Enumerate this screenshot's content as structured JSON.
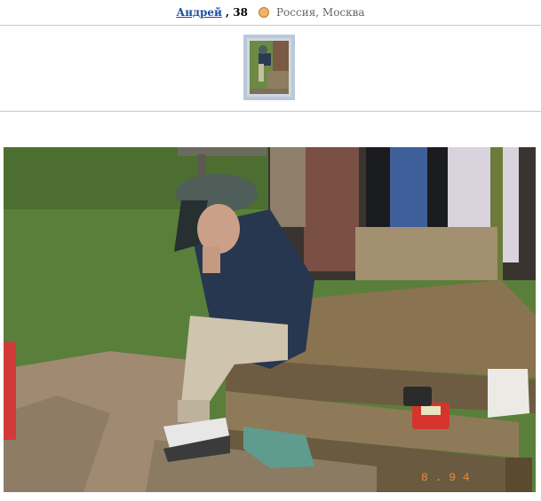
{
  "profile": {
    "name": "Андрей",
    "age": ", 38",
    "zodiac_icon": "zodiac-icon",
    "location": "Россия, Москва"
  },
  "photo": {
    "stamp": "8 . 9 4",
    "colors": {
      "grass": "#5a7f3a",
      "wood": "#8a7350",
      "jacket": "#26374f",
      "hat": "#4f5e58"
    }
  }
}
